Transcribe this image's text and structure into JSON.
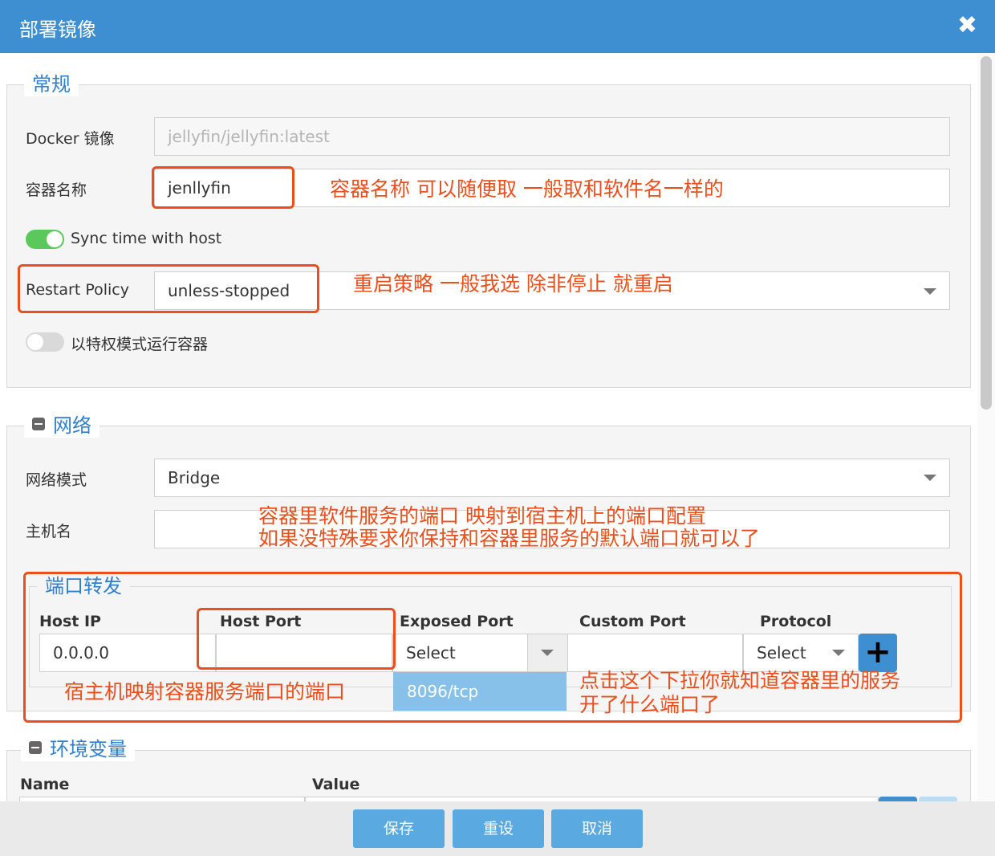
{
  "dialog": {
    "title": "部署镜像",
    "close_glyph": "✖"
  },
  "general": {
    "legend": "常规",
    "docker_image_label": "Docker 镜像",
    "docker_image_value": "jellyfin/jellyfin:latest",
    "container_name_label": "容器名称",
    "container_name_value": "jenllyfin",
    "sync_time_label": "Sync time with host",
    "sync_time_on": true,
    "restart_policy_label": "Restart Policy",
    "restart_policy_value": "unless-stopped",
    "privileged_label": "以特权模式运行容器",
    "privileged_on": false
  },
  "network": {
    "legend": "网络",
    "mode_label": "网络模式",
    "mode_value": "Bridge",
    "hostname_label": "主机名",
    "hostname_value": ""
  },
  "port_forward": {
    "legend": "端口转发",
    "columns": {
      "host_ip": "Host IP",
      "host_port": "Host Port",
      "exposed_port": "Exposed Port",
      "custom_port": "Custom Port",
      "protocol": "Protocol"
    },
    "host_ip_value": "0.0.0.0",
    "host_port_value": "",
    "exposed_port_value": "Select",
    "custom_port_value": "",
    "protocol_value": "Select",
    "exposed_port_options": [
      "8096/tcp"
    ],
    "add_glyph": "+"
  },
  "env": {
    "legend": "环境变量",
    "columns": {
      "name": "Name",
      "value": "Value"
    }
  },
  "footer": {
    "save": "保存",
    "reset": "重设",
    "cancel": "取消"
  },
  "annotations": {
    "container_name": "容器名称 可以随便取 一般取和软件名一样的",
    "restart_policy": "重启策略  一般我选 除非停止 就重启",
    "port_line1": "容器里软件服务的端口 映射到宿主机上的端口配置",
    "port_line2": "如果没特殊要求你保持和容器里服务的默认端口就可以了",
    "host_port": "宿主机映射容器服务端口的端口",
    "exposed_line1": "点击这个下拉你就知道容器里的服务",
    "exposed_line2": "开了什么端口了"
  },
  "colors": {
    "title_bar": "#3d8fd1",
    "annotation": "#ec4f1c",
    "accent": "#2f7fd1",
    "toggle_on": "#5ac85a"
  }
}
